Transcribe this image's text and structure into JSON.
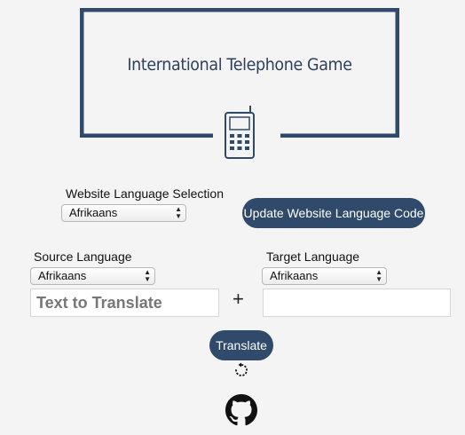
{
  "header": {
    "title": "International Telephone Game"
  },
  "website_language": {
    "label": "Website Language Selection",
    "selected": "Afrikaans",
    "update_button": "Update Website Language Code"
  },
  "source": {
    "label": "Source Language",
    "selected": "Afrikaans",
    "placeholder": "Text to Translate"
  },
  "target": {
    "label": "Target Language",
    "selected": "Afrikaans"
  },
  "plus_symbol": "+",
  "translate_button": "Translate",
  "icons": {
    "phone": "mobile-phone-icon",
    "refresh": "refresh-icon",
    "github": "github-icon"
  },
  "colors": {
    "accent": "#2f4a6b",
    "background": "#f4f4f4"
  }
}
